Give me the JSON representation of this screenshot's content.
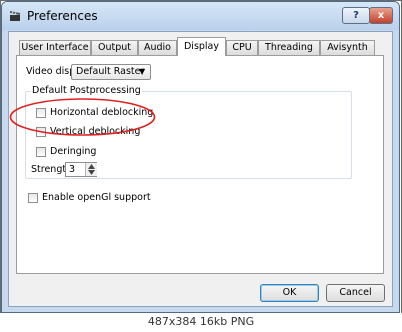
{
  "window": {
    "title": "Preferences",
    "help_glyph": "?",
    "close_glyph": "x"
  },
  "tabs": [
    {
      "label": "User Interface",
      "active": false
    },
    {
      "label": "Output",
      "active": false
    },
    {
      "label": "Audio",
      "active": false
    },
    {
      "label": "Display",
      "active": true
    },
    {
      "label": "CPU",
      "active": false
    },
    {
      "label": "Threading",
      "active": false
    },
    {
      "label": "Avisynth",
      "active": false
    }
  ],
  "display": {
    "video_display_label": "Video display:",
    "video_display_value": "Default Raster",
    "postprocessing_group_title": "Default Postprocessing",
    "horizontal_deblocking": {
      "label": "Horizontal deblocking",
      "checked": false
    },
    "vertical_deblocking": {
      "label": "Vertical deblocking",
      "checked": false
    },
    "deringing": {
      "label": "Deringing",
      "checked": false
    },
    "strength_label": "Strength:",
    "strength_value": "3",
    "opengl": {
      "label": "Enable openGl support",
      "checked": false
    }
  },
  "buttons": {
    "ok": "OK",
    "cancel": "Cancel"
  },
  "annotation": {
    "color": "#e02020"
  },
  "caption": "487x384  16kb  PNG"
}
